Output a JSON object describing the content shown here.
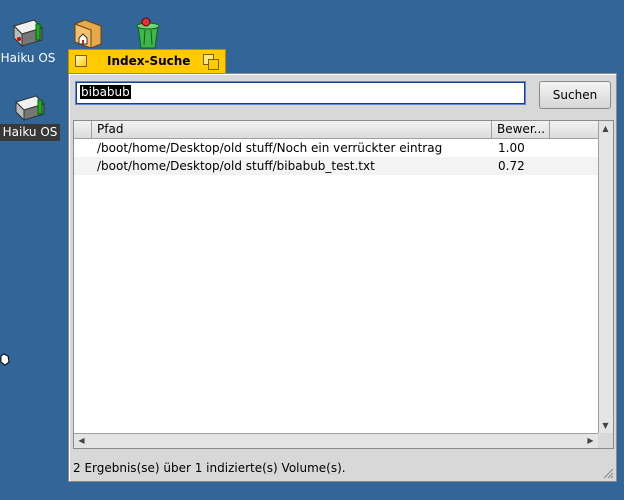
{
  "desktop": {
    "icons": [
      {
        "name": "haiku-os-volume-icon",
        "label": "Haiku OS",
        "selected": false
      },
      {
        "name": "home-folder-icon",
        "label": ""
      },
      {
        "name": "trash-icon",
        "label": ""
      },
      {
        "name": "haiku-os-volume-icon-2",
        "label": "Haiku OS",
        "selected": true
      }
    ]
  },
  "window": {
    "title": "Index-Suche"
  },
  "search": {
    "value": "bibabub",
    "button_label": "Suchen"
  },
  "results": {
    "columns": [
      "Pfad",
      "Bewer..."
    ],
    "rows": [
      {
        "path": "/boot/home/Desktop/old stuff/Noch ein verrückter eintrag",
        "score": "1.00"
      },
      {
        "path": "/boot/home/Desktop/old stuff/bibabub_test.txt",
        "score": "0.72"
      }
    ]
  },
  "status": "2 Ergebnis(se) über 1 indizierte(s) Volume(s).",
  "colors": {
    "desktop": "#336698",
    "tab": "#ffcb00",
    "window": "#d8d8d8"
  }
}
